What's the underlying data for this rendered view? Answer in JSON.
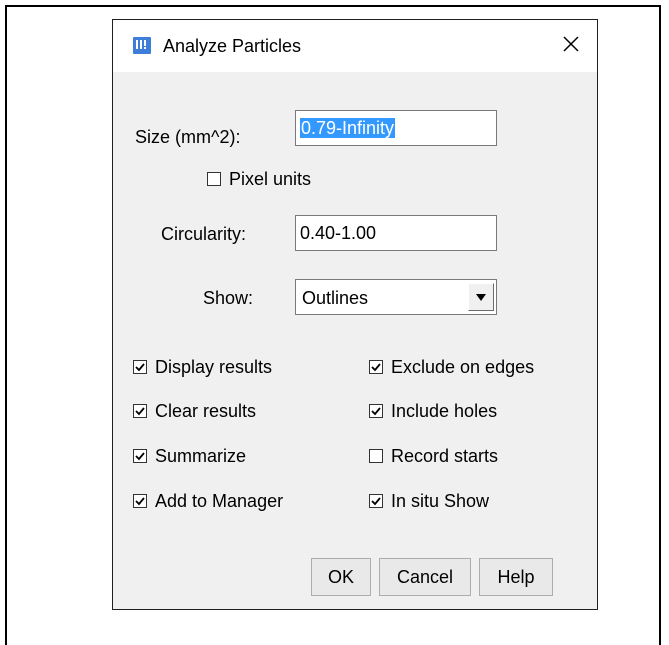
{
  "dialog": {
    "title": "Analyze Particles",
    "app_icon": "imagej-icon",
    "close_icon": "close-icon"
  },
  "fields": {
    "size_label": "Size (mm^2):",
    "size_value": "0.79-Infinity",
    "pixel_units_label": "Pixel units",
    "pixel_units_checked": false,
    "circularity_label": "Circularity:",
    "circularity_value": "0.40-1.00",
    "show_label": "Show:",
    "show_value": "Outlines"
  },
  "options": {
    "display_results": {
      "label": "Display results",
      "checked": true
    },
    "clear_results": {
      "label": "Clear results",
      "checked": true
    },
    "summarize": {
      "label": "Summarize",
      "checked": true
    },
    "add_to_manager": {
      "label": "Add to Manager",
      "checked": true
    },
    "exclude_on_edges": {
      "label": "Exclude on edges",
      "checked": true
    },
    "include_holes": {
      "label": "Include holes",
      "checked": true
    },
    "record_starts": {
      "label": "Record starts",
      "checked": false
    },
    "in_situ_show": {
      "label": "In situ Show",
      "checked": true
    }
  },
  "buttons": {
    "ok": "OK",
    "cancel": "Cancel",
    "help": "Help"
  },
  "colors": {
    "dialog_bg": "#f0f0f0",
    "selection": "#3399ff",
    "icon_blue": "#3d7edb"
  }
}
